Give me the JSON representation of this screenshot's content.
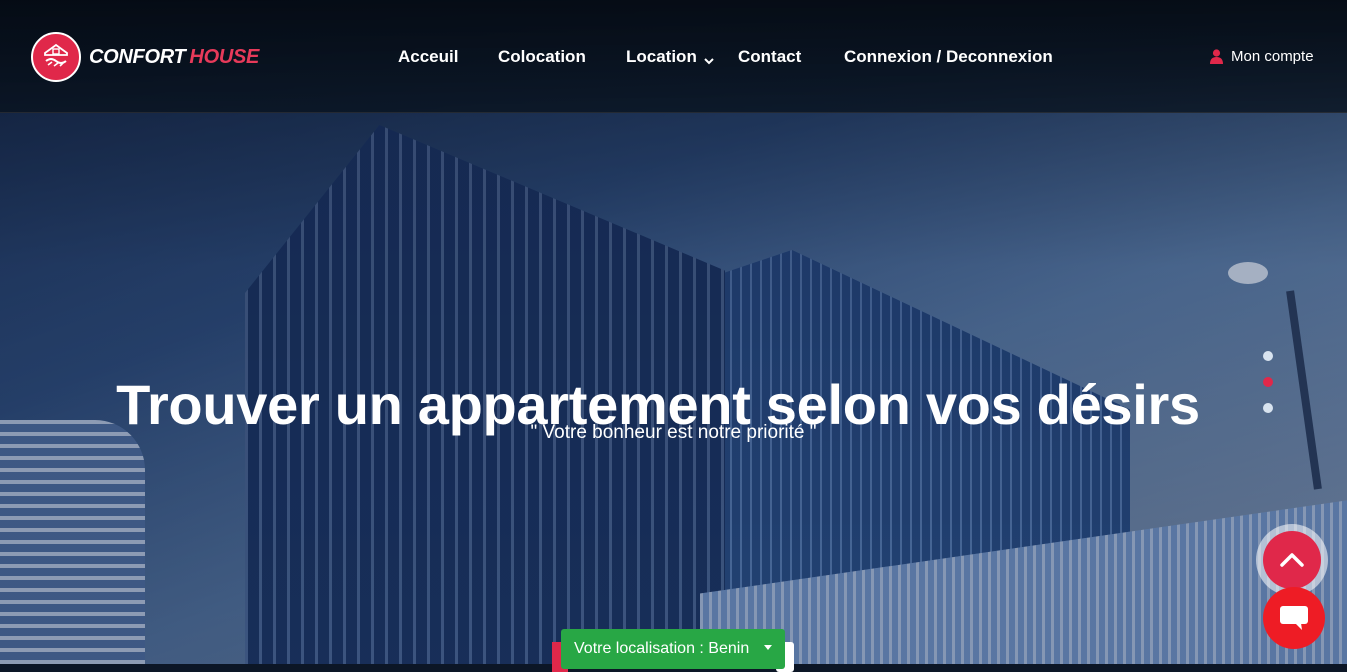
{
  "brand": {
    "name_part1": "CONFORT",
    "name_part2": "HOUSE"
  },
  "nav": {
    "items": [
      {
        "label": "Acceuil"
      },
      {
        "label": "Colocation"
      },
      {
        "label": "Location"
      },
      {
        "label": "Contact"
      },
      {
        "label": "Connexion / Deconnexion"
      }
    ],
    "account_label": "Mon compte"
  },
  "hero": {
    "title": "Trouver un appartement selon vos désirs",
    "subtitle": "\" Votre bonheur est notre priorité \"",
    "slider_active_index": 1,
    "slider_count": 3
  },
  "location_selector": {
    "label": "Votre localisation : Benin"
  },
  "icons": {
    "account": "user-icon",
    "dropdown": "chevron-down-icon",
    "scroll_top": "chevron-up-icon",
    "chat": "chat-bubble-icon"
  },
  "colors": {
    "accent": "#e0284a",
    "success": "#28a745",
    "chat": "#ee1c25"
  }
}
